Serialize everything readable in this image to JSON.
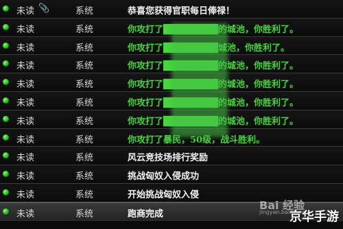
{
  "mail_list": [
    {
      "status": "未读",
      "has_attachment": true,
      "sender": "系统",
      "subject": "恭喜您获得官职每日俸禄！",
      "color": "white"
    },
    {
      "status": "未读",
      "sender": "系统",
      "subject": "你攻打了████████的城池，你胜利了。",
      "color": "green"
    },
    {
      "status": "未读",
      "sender": "系统",
      "subject": "你攻打了████████城池，你胜利了。",
      "color": "green"
    },
    {
      "status": "未读",
      "sender": "系统",
      "subject": "你攻打了████████的城池，你胜利了。",
      "color": "green"
    },
    {
      "status": "未读",
      "sender": "系统",
      "subject": "你攻打了████████的城池，你胜利了。",
      "color": "green"
    },
    {
      "status": "未读",
      "sender": "系统",
      "subject": "你攻打了████████的城池，你胜利了。",
      "color": "green"
    },
    {
      "status": "未读",
      "sender": "系统",
      "subject": "你攻打了████████的城池，你胜利了。",
      "color": "green"
    },
    {
      "status": "未读",
      "sender": "系统",
      "subject": "你攻打了暴民，50级，战斗胜利。",
      "color": "green"
    },
    {
      "status": "未读",
      "sender": "系统",
      "subject": "风云竞技场排行奖励",
      "color": "white"
    },
    {
      "status": "未读",
      "sender": "系统",
      "subject": "挑战匈奴入侵成功",
      "color": "white"
    },
    {
      "status": "未读",
      "sender": "系统",
      "subject": "开始挑战匈奴入侵",
      "color": "white"
    },
    {
      "status": "未读",
      "sender": "系统",
      "subject": "跑商完成",
      "color": "white",
      "selected": true
    }
  ],
  "watermark": {
    "text": "Bai 经验",
    "sub": "jingyan.baidu.com"
  },
  "brand": "京华手游",
  "colors": {
    "unread_dot": "#2fc62a",
    "subject_green": "#46d63c",
    "subject_white": "#f2f2f2"
  }
}
